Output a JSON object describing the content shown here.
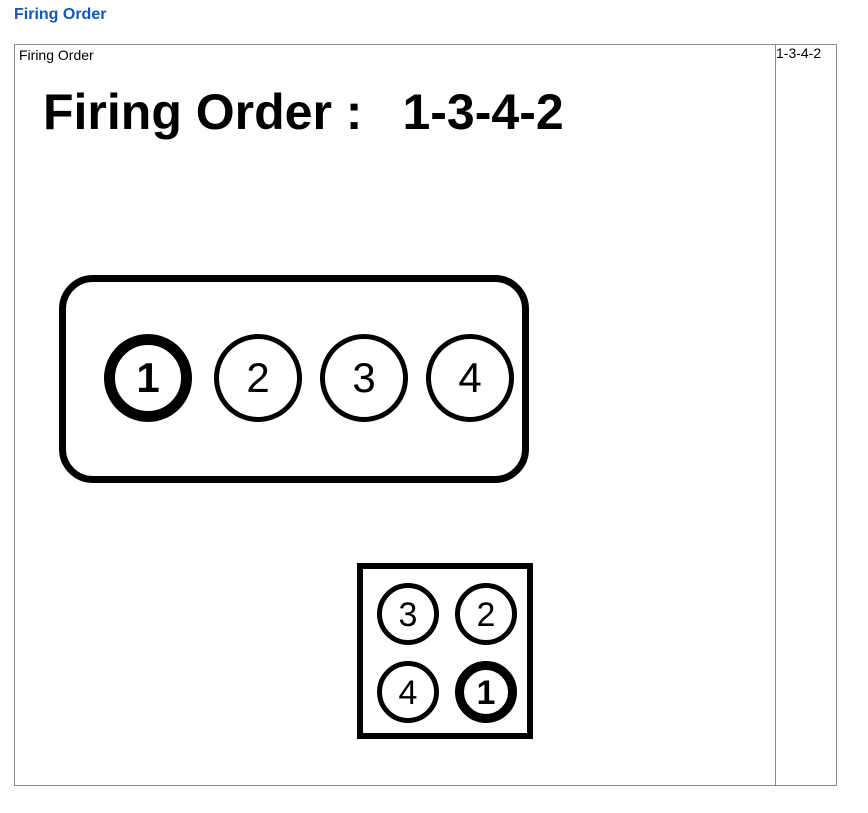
{
  "heading": "Firing Order",
  "table_caption": "Firing Order",
  "side_label": "1-3-4-2",
  "diagram": {
    "title_label": "Firing Order :",
    "title_order": "1-3-4-2",
    "cylinders": [
      "1",
      "2",
      "3",
      "4"
    ],
    "distributor": {
      "top_left": "3",
      "top_right": "2",
      "bottom_left": "4",
      "bottom_right": "1"
    }
  }
}
